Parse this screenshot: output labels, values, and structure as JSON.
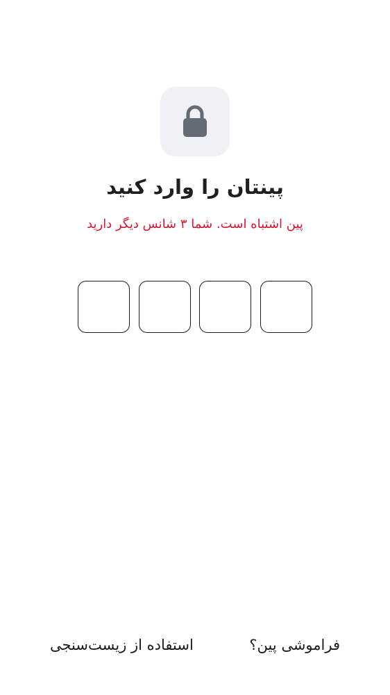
{
  "lock": {
    "icon": "lock-icon",
    "tile_color": "#f0f1f4",
    "icon_color": "#656b75"
  },
  "header": {
    "title": "پینتان را وارد کنید",
    "error_message": "پین اشتباه است. شما ۳ شانس دیگر دارید"
  },
  "pin": {
    "length": 4,
    "digits": [
      "",
      "",
      "",
      ""
    ]
  },
  "footer": {
    "biometric_label": "استفاده از زیست‌سنجی",
    "forgot_label": "فراموشی پین؟"
  },
  "colors": {
    "error": "#d0182f",
    "text": "#1c1c1e"
  }
}
